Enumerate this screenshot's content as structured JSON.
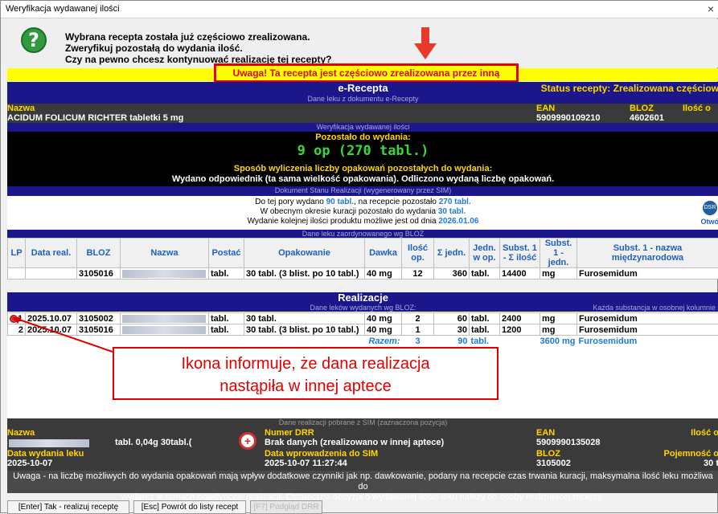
{
  "window": {
    "title": "Weryfikacja wydawanej ilości",
    "close": "×"
  },
  "message": {
    "icon": "question-icon",
    "line1": "Wybrana recepta została już częściowo zrealizowana.",
    "line2": "Zweryfikuj pozostałą do wydania ilość.",
    "line3": "Czy na pewno chcesz kontynuować realizację tej recepty?",
    "warning": "Uwaga! Ta recepta jest częściowo zrealizowana przez inną aptekę."
  },
  "erecepta": {
    "title": "e-Recepta",
    "status": "Status recepty: Zrealizowana częściow",
    "sub": "Dane leku z dokumentu e-Recepty",
    "nazwa_label": "Nazwa",
    "nazwa_value": "ACIDUM FOLICUM RICHTER tabletki 5 mg",
    "ean_label": "EAN",
    "ean_value": "5909990109210",
    "bloz_label": "BLOZ",
    "bloz_value": "4602601",
    "ilosc_label": "Ilość o"
  },
  "weryfikacja": {
    "sub": "Weryfikacja wydawanej ilości",
    "pozostalo_label": "Pozostało do wydania:",
    "pozostalo_value": "9 op (270 tabl.)",
    "sposob_label": "Sposób wyliczenia liczby opakowań pozostałych do wydania:",
    "sposob_value": "Wydano odpowiednik (ta sama wielkość opakowania). Odliczono wydaną liczbę opakowań."
  },
  "dokument": {
    "sub": "Dokument Stanu Realizacji (wygenerowany przez SIM)",
    "l1_a": "Do tej pory wydano ",
    "l1_b": "90 tabl.",
    "l1_c": ", na recepcie pozostało ",
    "l1_d": "270 tabl.",
    "l2_a": "W obecnym okresie kuracji pozostało do wydania ",
    "l2_b": "30 tabl.",
    "l3_a": "Wydanie kolejnej ilości produktu możliwe jest od dnia ",
    "l3_b": "2026.01.06",
    "dsr": "DSR",
    "otworz": "Otwó"
  },
  "table": {
    "sub": "Dane leku zaordynowanego wg BLOZ",
    "headers": [
      "LP",
      "Data real.",
      "BLOZ",
      "Nazwa",
      "Postać",
      "Opakowanie",
      "Dawka",
      "Ilość op.",
      "Σ jedn.",
      "Jedn. w op.",
      "Subst. 1 - Σ ilość",
      "Subst. 1 - jedn.",
      "Subst. 1 - nazwa międzynarodowa"
    ],
    "ordered": [
      "",
      "",
      "3105016",
      "",
      "tabl.",
      "30 tabl. (3 blist. po 10 tabl.)",
      "40 mg",
      "12",
      "360",
      "tabl.",
      "14400",
      "mg",
      "Furosemidum"
    ],
    "realizacje_title": "Realizacje",
    "realizacje_sub": "Dane leków wydanych wg BLOZ:",
    "realizacje_sub_right": "Każda substancja w osobnej kolumnie",
    "rows": [
      [
        "1",
        "2025.10.07",
        "3105002",
        "",
        "tabl.",
        "30 tabl.",
        "40 mg",
        "2",
        "60",
        "tabl.",
        "2400",
        "mg",
        "Furosemidum"
      ],
      [
        "2",
        "2025.10.07",
        "3105016",
        "",
        "tabl.",
        "30 tabl. (3 blist. po 10 tabl.)",
        "40 mg",
        "1",
        "30",
        "tabl.",
        "1200",
        "mg",
        "Furosemidum"
      ]
    ],
    "razem_label": "Razem:",
    "razem": [
      "3",
      "90",
      "tabl.",
      "3600 mg",
      "Furosemidum"
    ]
  },
  "callout": {
    "line1": "Ikona informuje, że dana realizacja",
    "line2": "nastąpiła w innej aptece"
  },
  "bottom": {
    "sub": "Dane realizacji pobrane z SIM (zaznaczona pozycja)",
    "nazwa_label": "Nazwa",
    "nazwa_value": "tabl. 0,04g 30tabl.(",
    "numer_label": "Numer DRR",
    "numer_value": "Brak danych (zrealizowano w innej aptece)",
    "ean_label": "EAN",
    "ean_value": "5909990135028",
    "ilosc_label": "Ilość o",
    "data_wyd_label": "Data wydania leku",
    "data_wyd_value": "2025-10-07",
    "data_wpr_label": "Data wprowadzenia do SIM",
    "data_wpr_value": "2025-10-07 11:27:44",
    "bloz_label": "BLOZ",
    "bloz_value": "3105002",
    "pojemnosc_label": "Pojemność o",
    "pojemnosc_value": "30 t"
  },
  "warning_text1": "Uwaga - na liczbę możliwych do wydania opakowań mają wpływ dodatkowe czynniki jak np. dawkowanie, podany na recepcie czas trwania kuracji, maksymalna ilość leku możliwa do",
  "warning_text2": "wydania w ramach pojedynczej realizacji. Ostateczna decyzja o wydawanej ilości leku należy do osoby realizującej receptę.",
  "buttons": {
    "yes": "[Enter] Tak - realizuj receptę",
    "back": "[Esc] Powrót do listy recept",
    "preview": "[F7] Podgląd DRR"
  }
}
